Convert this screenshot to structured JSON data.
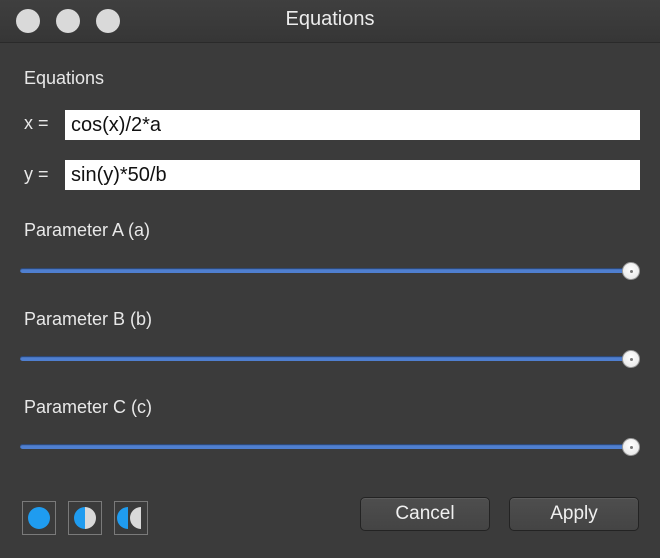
{
  "window": {
    "title": "Equations"
  },
  "equations": {
    "section_label": "Equations",
    "x_label": "x =",
    "x_value": "cos(x)/2*a",
    "y_label": "y =",
    "y_value": "sin(y)*50/b"
  },
  "parameters": [
    {
      "label": "Parameter A (a)",
      "value_fraction": 1.0
    },
    {
      "label": "Parameter B (b)",
      "value_fraction": 1.0
    },
    {
      "label": "Parameter C (c)",
      "value_fraction": 1.0
    }
  ],
  "buttons": {
    "cancel": "Cancel",
    "apply": "Apply"
  },
  "icons": [
    "full-circle-icon",
    "half-circle-icon",
    "double-half-circle-icon"
  ],
  "colors": {
    "accent": "#4f7fd0",
    "icon_blue": "#1f9cf0",
    "background": "#3b3b3b"
  }
}
